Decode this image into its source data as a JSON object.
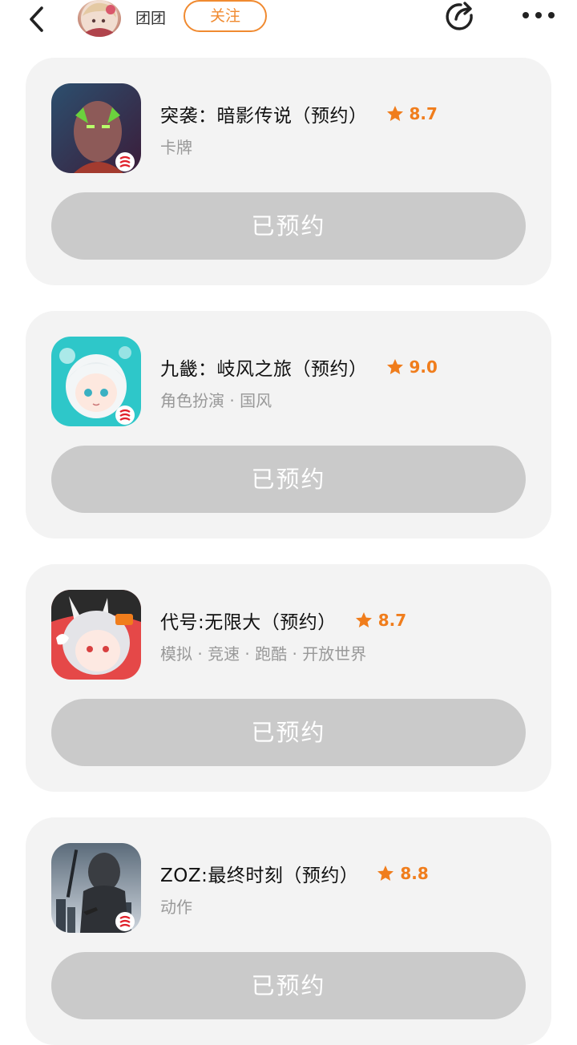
{
  "header": {
    "author_name": "团团",
    "follow_label": "关注",
    "icons": [
      "back-icon",
      "avatar",
      "share-icon",
      "more-icon"
    ]
  },
  "colors": {
    "accent": "#f08a30",
    "rating": "#f07d1c",
    "card_bg": "#f3f3f3",
    "button_bg": "#cacaca"
  },
  "games": [
    {
      "title": "突袭：暗影传说（预约）",
      "rating": "8.7",
      "tags": "卡牌",
      "button_label": "已预约"
    },
    {
      "title": "九畿：岐风之旅（预约）",
      "rating": "9.0",
      "tags": "角色扮演 · 国风",
      "button_label": "已预约"
    },
    {
      "title": "代号:无限大（预约）",
      "rating": "8.7",
      "tags": "模拟 · 竞速 · 跑酷 · 开放世界",
      "button_label": "已预约"
    },
    {
      "title": "ZOZ:最终时刻（预约）",
      "rating": "8.8",
      "tags": "动作",
      "button_label": "已预约"
    }
  ]
}
